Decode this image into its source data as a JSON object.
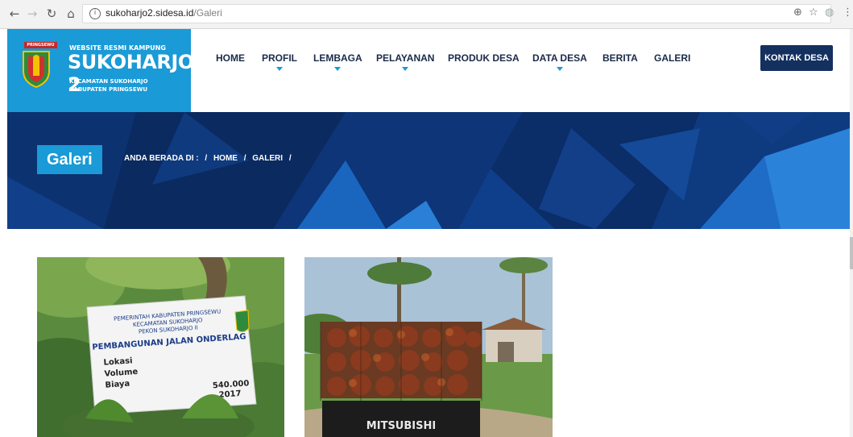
{
  "browser": {
    "url_host": "sukoharjo2.sidesa.id",
    "url_path": "/Galeri"
  },
  "logo": {
    "tag": "PRINGSEWU",
    "line1": "WEBSITE RESMI KAMPUNG",
    "line2": "SUKOHARJO 2",
    "line3": "KECAMATAN SUKOHARJO",
    "line4": "KABUPATEN PRINGSEWU"
  },
  "menu": {
    "items": [
      {
        "label": "HOME"
      },
      {
        "label": "PROFIL"
      },
      {
        "label": "LEMBAGA"
      },
      {
        "label": "PELAYANAN"
      },
      {
        "label": "PRODUK DESA"
      },
      {
        "label": "DATA DESA"
      },
      {
        "label": "BERITA"
      },
      {
        "label": "GALERI"
      }
    ],
    "contact_label": "KONTAK DESA"
  },
  "hero": {
    "title": "Galeri",
    "breadcrumb": [
      "ANDA BERADA DI :",
      "/",
      "HOME",
      "/",
      "GALERI",
      "/"
    ]
  },
  "gallery": {
    "photo1": {
      "sign_l1": "PEMERINTAH KABUPATEN PRINGSEWU",
      "sign_l2": "KECAMATAN SUKOHARJO",
      "sign_l3": "PEKON SUKOHARJO II",
      "sign_l4": "PEMBANGUNAN JALAN ONDERLAG",
      "sign_l5": "Lokasi",
      "sign_l6": "Volume",
      "sign_l7": "Biaya",
      "sign_l8": "540.000",
      "sign_l9": "2017"
    },
    "photo2": {
      "truck_brand": "MITSUBISHI"
    }
  },
  "colors": {
    "brand_blue": "#1a9ad6",
    "navy": "#14305e",
    "hero_bg": "#0b2c66"
  }
}
